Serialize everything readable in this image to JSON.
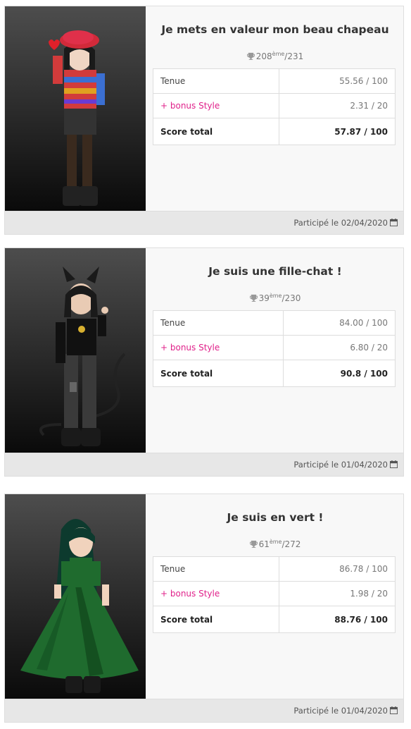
{
  "cards": [
    {
      "title": "Je mets en valeur mon beau chapeau",
      "rank": "208",
      "rank_suffix": "ème",
      "rank_total": "/231",
      "rows": [
        {
          "label": "Tenue",
          "value": "55.56 / 100"
        },
        {
          "label": "+ bonus Style",
          "value": "2.31 / 20"
        },
        {
          "label": "Score total",
          "value": "57.87 / 100"
        }
      ],
      "participated": "Participé le 02/04/2020"
    },
    {
      "title": "Je suis une fille-chat !",
      "rank": "39",
      "rank_suffix": "ème",
      "rank_total": "/230",
      "rows": [
        {
          "label": "Tenue",
          "value": "84.00 / 100"
        },
        {
          "label": "+ bonus Style",
          "value": "6.80 / 20"
        },
        {
          "label": "Score total",
          "value": "90.8 / 100"
        }
      ],
      "participated": "Participé le 01/04/2020"
    },
    {
      "title": "Je suis en vert !",
      "rank": "61",
      "rank_suffix": "ème",
      "rank_total": "/272",
      "rows": [
        {
          "label": "Tenue",
          "value": "86.78 / 100"
        },
        {
          "label": "+ bonus Style",
          "value": "1.98 / 20"
        },
        {
          "label": "Score total",
          "value": "88.76 / 100"
        }
      ],
      "participated": "Participé le 01/04/2020"
    }
  ],
  "icons": {
    "rank": "trophy-icon",
    "date": "calendar-icon"
  },
  "colors": {
    "bonus": "#e0218a",
    "footer": "#e7e7e7",
    "card": "#f8f8f8"
  }
}
